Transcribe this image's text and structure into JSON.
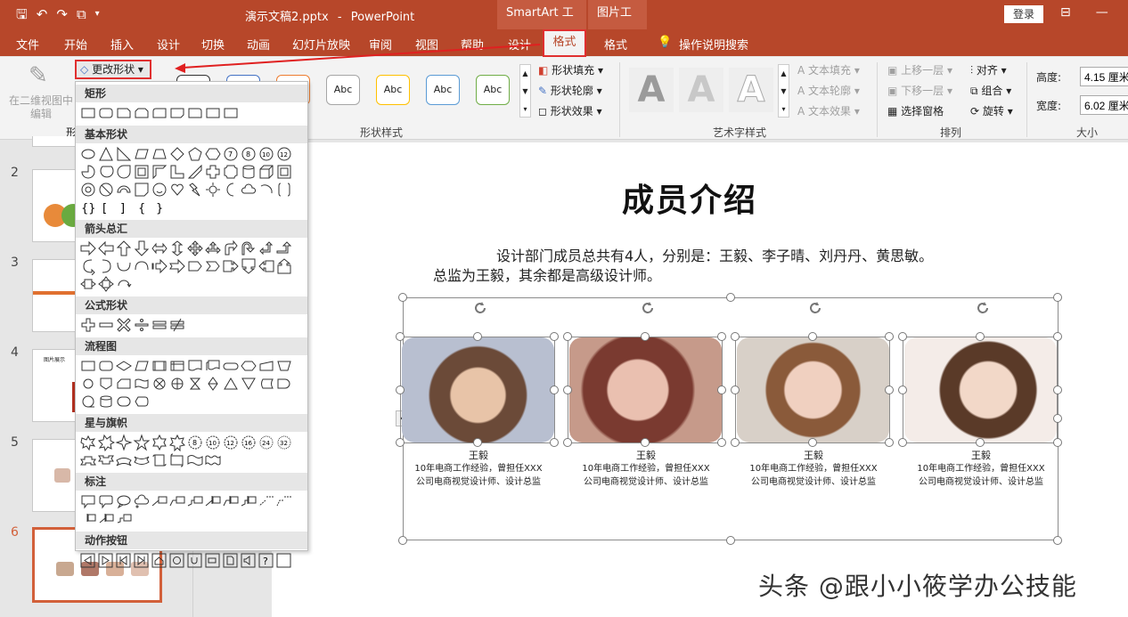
{
  "titlebar": {
    "file_title": "演示文稿2.pptx",
    "app_sep": "-",
    "app_name": "PowerPoint",
    "ctx_smartart": "SmartArt 工具",
    "ctx_picture": "图片工具",
    "login": "登录"
  },
  "tabs": [
    "文件",
    "开始",
    "插入",
    "设计",
    "切换",
    "动画",
    "幻灯片放映",
    "审阅",
    "视图",
    "帮助",
    "设计",
    "格式",
    "格式"
  ],
  "tellme": "操作说明搜索",
  "ribbon": {
    "edit_2d_line1": "在二维视图中",
    "edit_2d_line2": "编辑",
    "change_shape": "更改形状",
    "abc": "Abc",
    "shape_fill": "形状填充",
    "shape_outline": "形状轮廓",
    "shape_effects": "形状效果",
    "group_shape_styles": "形状样式",
    "art_letter": "A",
    "text_fill": "文本填充",
    "text_outline": "文本轮廓",
    "text_effects": "文本效果",
    "group_art": "艺术字样式",
    "bring_forward": "上移一层",
    "send_backward": "下移一层",
    "selection_pane": "选择窗格",
    "align": "对齐",
    "group": "组合",
    "rotate": "旋转",
    "group_arrange": "排列",
    "height_label": "高度:",
    "height_value": "4.15 厘米",
    "width_label": "宽度:",
    "width_value": "6.02 厘米",
    "group_size": "大小",
    "group_partial": "形"
  },
  "shapes_menu": {
    "categories": [
      "矩形",
      "基本形状",
      "箭头总汇",
      "公式形状",
      "流程图",
      "星与旗帜",
      "标注",
      "动作按钮"
    ]
  },
  "thumbnails": {
    "numbers": [
      "2",
      "3",
      "4",
      "5",
      "6"
    ],
    "thumb4_text": "图片展示"
  },
  "slide": {
    "title": "成员介绍",
    "line1": "设计部门成员总共有4人，分别是：王毅、李子晴、刘丹丹、黄思敏。",
    "line2": "总监为王毅，其余都是高级设计师。",
    "members": [
      {
        "name": "王毅",
        "desc1": "10年电商工作经验，曾担任XXX",
        "desc2": "公司电商视觉设计师、设计总监"
      },
      {
        "name": "王毅",
        "desc1": "10年电商工作经验，曾担任XXX",
        "desc2": "公司电商视觉设计师、设计总监"
      },
      {
        "name": "王毅",
        "desc1": "10年电商工作经验，曾担任XXX",
        "desc2": "公司电商视觉设计师、设计总监"
      },
      {
        "name": "王毅",
        "desc1": "10年电商工作经验，曾担任XXX",
        "desc2": "公司电商视觉设计师、设计总监"
      }
    ]
  },
  "watermark": "头条 @跟小小筱学办公技能",
  "colors": {
    "accent": "#b7472a",
    "highlight": "#e03030"
  }
}
